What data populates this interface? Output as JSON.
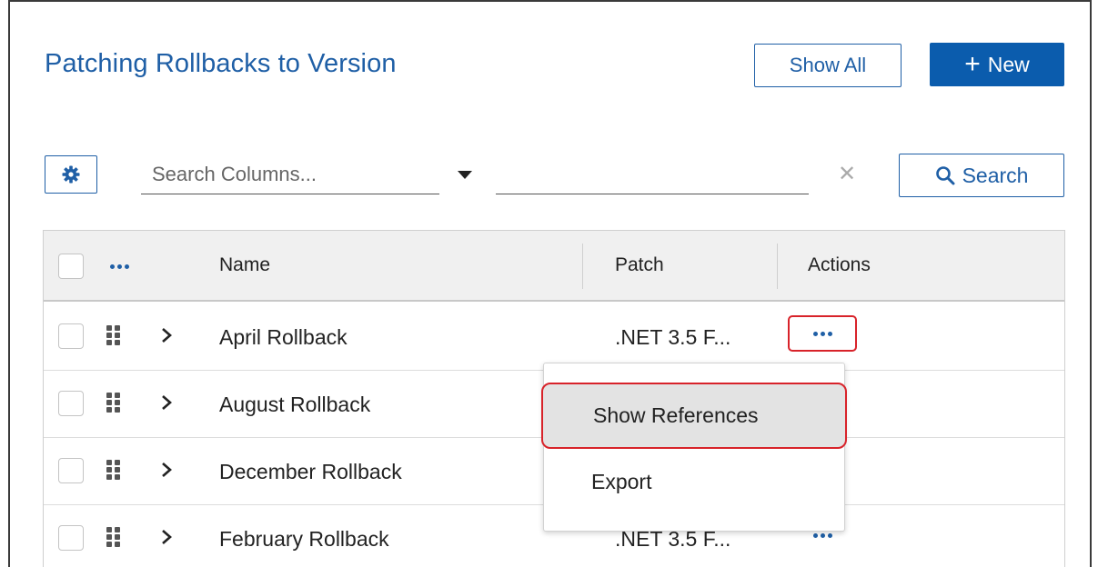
{
  "header": {
    "title": "Patching Rollbacks to Version",
    "show_all_label": "Show All",
    "new_label": "New"
  },
  "toolbar": {
    "settings_icon": "gear-icon",
    "search_placeholder": "Search Columns...",
    "search_value": "",
    "clear_icon": "close-icon",
    "search_button_label": "Search"
  },
  "table": {
    "columns": [
      "Name",
      "Patch",
      "Actions"
    ],
    "rows": [
      {
        "name": "April Rollback",
        "patch": ".NET 3.5 F..."
      },
      {
        "name": "August Rollback",
        "patch": ""
      },
      {
        "name": "December Rollback",
        "patch": ""
      },
      {
        "name": "February Rollback",
        "patch": ".NET 3.5 F..."
      }
    ]
  },
  "actions_menu": {
    "items": [
      "Show References",
      "Export"
    ],
    "active_item": "Show References"
  },
  "colors": {
    "accent": "#1f5fa6",
    "primary_button": "#0b5cad",
    "highlight": "#d8232a"
  }
}
